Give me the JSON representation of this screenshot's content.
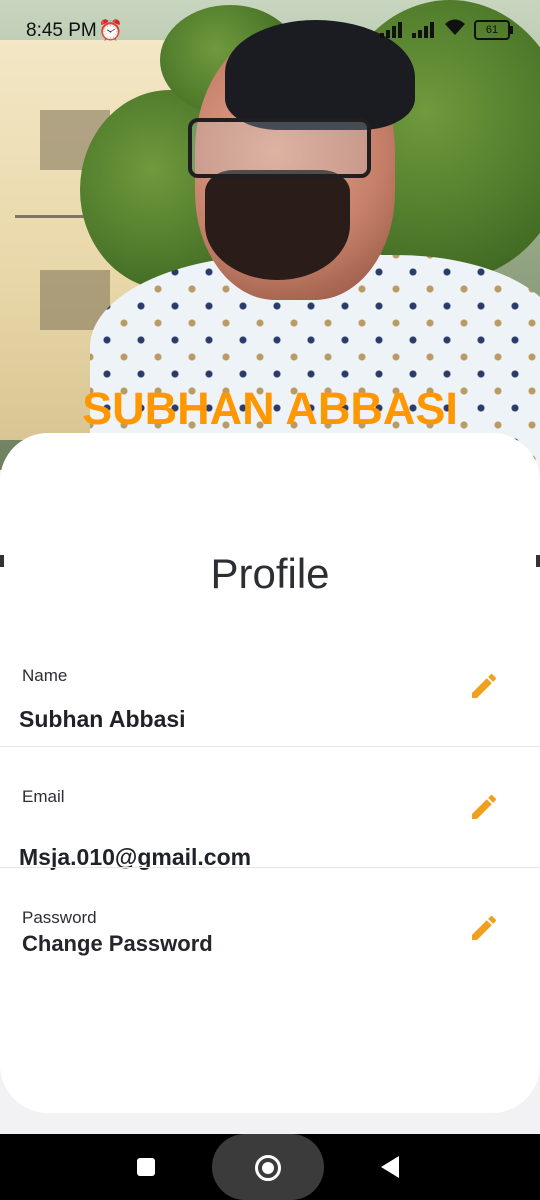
{
  "status_bar": {
    "time": "8:45 PM",
    "alarm_icon": "alarm-icon",
    "battery": "61"
  },
  "hero": {
    "name": "SUBHAN ABBASI",
    "name_color": "#ff9800"
  },
  "page": {
    "title": "Profile"
  },
  "fields": {
    "name": {
      "label": "Name",
      "value": "Subhan Abbasi"
    },
    "email": {
      "label": "Email",
      "value": "Msja.010@gmail.com"
    },
    "password": {
      "label": "Password",
      "value": "Change Password"
    }
  },
  "colors": {
    "accent": "#f0a01e",
    "card": "#ffffff",
    "text": "#2b2e33",
    "navbar": "#000000"
  },
  "nav": {
    "recents_icon": "square-icon",
    "home_icon": "home-circle-icon",
    "back_icon": "back-triangle-icon"
  }
}
